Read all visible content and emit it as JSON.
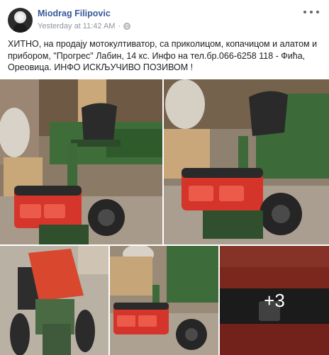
{
  "post": {
    "author": "Miodrag Filipovic",
    "timestamp": "Yesterday at 11:42 AM",
    "privacy_icon": "globe-icon",
    "text": "ХИТНО, на продају мотокултиватор, са приколицом, копачицом и алатом и прибором, \"Прогрес\" Лабин, 14 кс. Инфо на тел.бр.066-6258 118 - Фића, Ореовица. ИНФО ИСКЉУЧИВО ПОЗИВОМ !",
    "more_photos_label": "+3"
  },
  "colors": {
    "author_link": "#385898",
    "meta_text": "#90949c",
    "body_text": "#1c1e21"
  }
}
